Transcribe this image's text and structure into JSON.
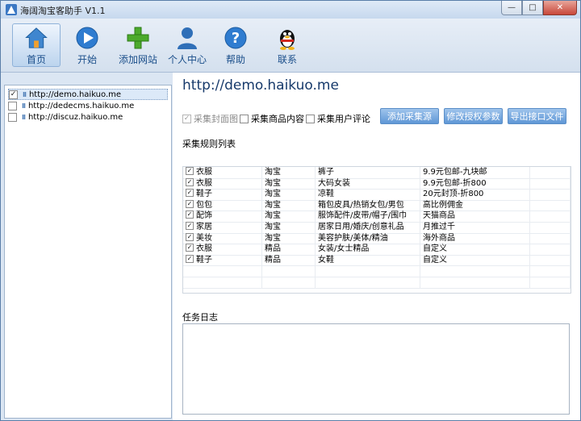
{
  "window": {
    "title": "海阔淘宝客助手 V1.1"
  },
  "titlebar_buttons": {
    "minimize": "—",
    "maximize": "□",
    "close": "✕"
  },
  "toolbar": {
    "items": [
      {
        "label": "首页",
        "icon": "home-icon"
      },
      {
        "label": "开始",
        "icon": "play-icon"
      },
      {
        "label": "添加网站",
        "icon": "plus-icon"
      },
      {
        "label": "个人中心",
        "icon": "user-icon"
      },
      {
        "label": "帮助",
        "icon": "help-icon"
      },
      {
        "label": "联系",
        "icon": "qq-penguin-icon"
      }
    ]
  },
  "sites": [
    {
      "checked": true,
      "url": "http://demo.haikuo.me",
      "selected": true
    },
    {
      "checked": false,
      "url": "http://dedecms.haikuo.me",
      "selected": false
    },
    {
      "checked": false,
      "url": "http://discuz.haikuo.me",
      "selected": false
    }
  ],
  "main": {
    "url_title": "http://demo.haikuo.me",
    "options": [
      {
        "label": "采集封面图",
        "checked": true,
        "disabled": true
      },
      {
        "label": "采集商品内容",
        "checked": false,
        "disabled": false
      },
      {
        "label": "采集用户评论",
        "checked": false,
        "disabled": false
      }
    ],
    "buttons": {
      "add_source": "添加采集源",
      "edit_auth": "修改授权参数",
      "export_api": "导出接口文件"
    },
    "rules_label": "采集规则列表",
    "log_label": "任务日志"
  },
  "rules": [
    {
      "checked": true,
      "category": "衣服",
      "source": "淘宝",
      "keywords": "裤子",
      "channel": "9.9元包邮-九块邮"
    },
    {
      "checked": true,
      "category": "衣服",
      "source": "淘宝",
      "keywords": "大码女装",
      "channel": "9.9元包邮-折800"
    },
    {
      "checked": true,
      "category": "鞋子",
      "source": "淘宝",
      "keywords": "凉鞋",
      "channel": "20元封顶-折800"
    },
    {
      "checked": true,
      "category": "包包",
      "source": "淘宝",
      "keywords": "箱包皮具/热销女包/男包",
      "channel": "高比例佣金"
    },
    {
      "checked": true,
      "category": "配饰",
      "source": "淘宝",
      "keywords": "服饰配件/皮带/帽子/围巾",
      "channel": "天猫商品"
    },
    {
      "checked": true,
      "category": "家居",
      "source": "淘宝",
      "keywords": "居家日用/婚庆/创意礼品",
      "channel": "月推过千"
    },
    {
      "checked": true,
      "category": "美妆",
      "source": "淘宝",
      "keywords": "美容护肤/美体/精油",
      "channel": "海外商品"
    },
    {
      "checked": true,
      "category": "衣服",
      "source": "精品",
      "keywords": "女装/女士精品",
      "channel": "自定义"
    },
    {
      "checked": true,
      "category": "鞋子",
      "source": "精品",
      "keywords": "女鞋",
      "channel": "自定义"
    }
  ]
}
